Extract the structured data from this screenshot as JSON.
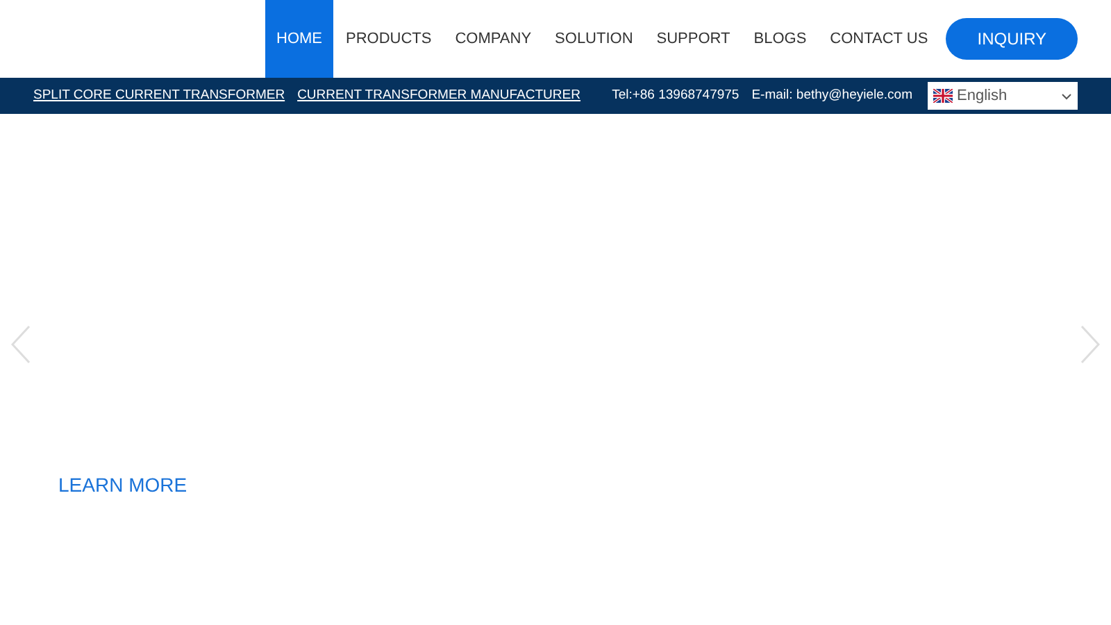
{
  "nav": [
    {
      "label": "HOME",
      "selected": true
    },
    {
      "label": "PRODUCTS",
      "selected": false
    },
    {
      "label": "COMPANY",
      "selected": false
    },
    {
      "label": "SOLUTION",
      "selected": false
    },
    {
      "label": "SUPPORT",
      "selected": false
    },
    {
      "label": "BLOGS",
      "selected": false
    },
    {
      "label": "CONTACT US",
      "selected": false
    }
  ],
  "inquiry_button": "INQUIRY",
  "top_bar": {
    "links": [
      "SPLIT CORE CURRENT TRANSFORMER",
      "CURRENT TRANSFORMER MANUFACTURER"
    ],
    "phone": "Tel:+86 13968747975",
    "email": "E-mail: bethy@heyiele.com",
    "language": "English"
  },
  "hero": {
    "button": "LEARN MORE"
  }
}
